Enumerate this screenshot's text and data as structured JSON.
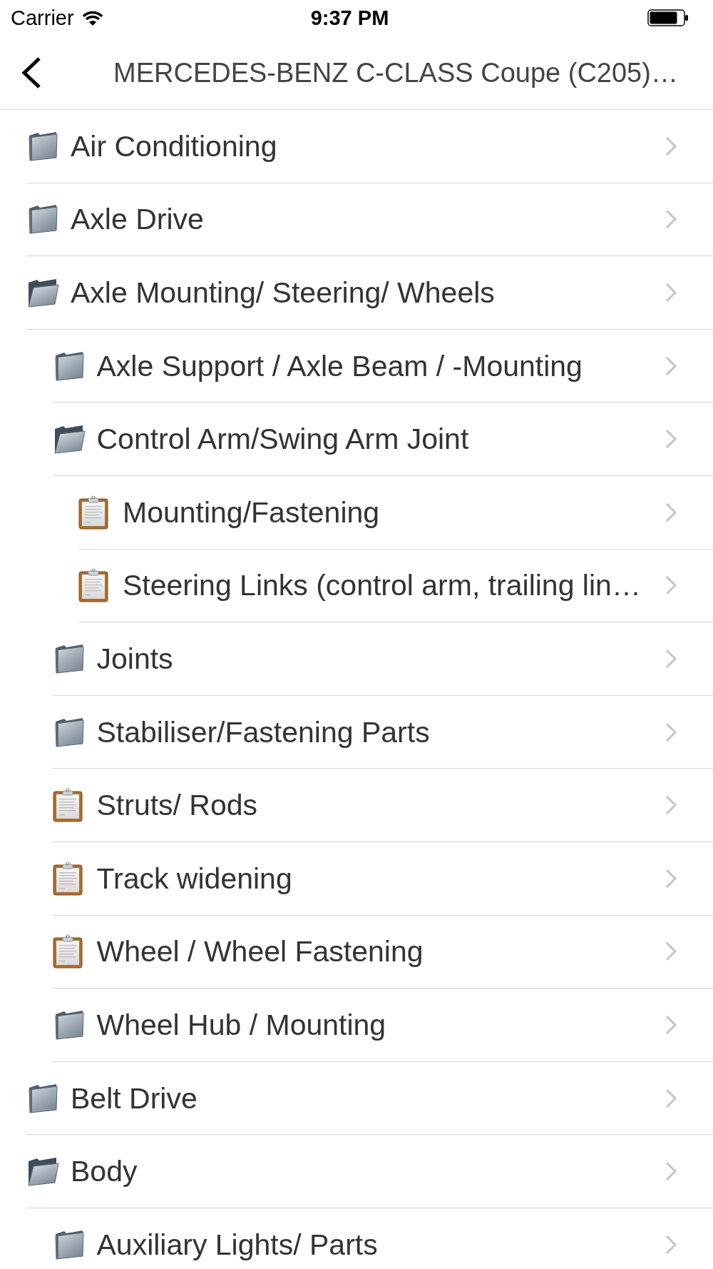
{
  "status_bar": {
    "carrier": "Carrier",
    "time": "9:37 PM"
  },
  "nav_bar": {
    "title": "MERCEDES-BENZ C-CLASS Coupe (C205)…"
  },
  "tree": [
    {
      "label": "Air Conditioning",
      "kind": "folder",
      "expanded": false
    },
    {
      "label": "Axle Drive",
      "kind": "folder",
      "expanded": false
    },
    {
      "label": "Axle Mounting/ Steering/ Wheels",
      "kind": "folder",
      "expanded": true,
      "children": [
        {
          "label": "Axle Support / Axle Beam / -Mounting",
          "kind": "folder",
          "expanded": false
        },
        {
          "label": "Control Arm/Swing Arm Joint",
          "kind": "folder",
          "expanded": true,
          "children": [
            {
              "label": "Mounting/Fastening",
              "kind": "document"
            },
            {
              "label": "Steering Links (control arm, trailing lin…",
              "kind": "document"
            }
          ]
        },
        {
          "label": "Joints",
          "kind": "folder",
          "expanded": false
        },
        {
          "label": "Stabiliser/Fastening Parts",
          "kind": "folder",
          "expanded": false
        },
        {
          "label": "Struts/ Rods",
          "kind": "document"
        },
        {
          "label": "Track widening",
          "kind": "document"
        },
        {
          "label": "Wheel / Wheel Fastening",
          "kind": "document"
        },
        {
          "label": "Wheel Hub / Mounting",
          "kind": "folder",
          "expanded": false
        }
      ]
    },
    {
      "label": "Belt Drive",
      "kind": "folder",
      "expanded": false
    },
    {
      "label": "Body",
      "kind": "folder",
      "expanded": true,
      "children": [
        {
          "label": "Auxiliary Lights/ Parts",
          "kind": "folder",
          "expanded": false
        }
      ]
    }
  ]
}
